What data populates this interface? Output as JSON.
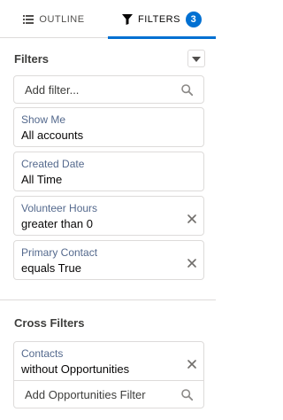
{
  "tabs": [
    {
      "label": "Outline",
      "icon": "list-icon",
      "active": false
    },
    {
      "label": "Filters",
      "icon": "filter-icon",
      "active": true,
      "badge": "3"
    }
  ],
  "filters_section": {
    "title": "Filters",
    "search_placeholder": "Add filter...",
    "items": [
      {
        "label": "Show Me",
        "value": "All accounts",
        "removable": false
      },
      {
        "label": "Created Date",
        "value": "All Time",
        "removable": false
      },
      {
        "label": "Volunteer Hours",
        "value": "greater than 0",
        "removable": true
      },
      {
        "label": "Primary Contact",
        "value": "equals True",
        "removable": true
      }
    ]
  },
  "cross_filters_section": {
    "title": "Cross Filters",
    "items": [
      {
        "label": "Contacts",
        "value": "without Opportunities",
        "removable": true
      }
    ],
    "search_placeholder": "Add Opportunities Filter"
  },
  "colors": {
    "accent": "#0070d2",
    "border": "#dddbda",
    "label": "#54698d"
  }
}
